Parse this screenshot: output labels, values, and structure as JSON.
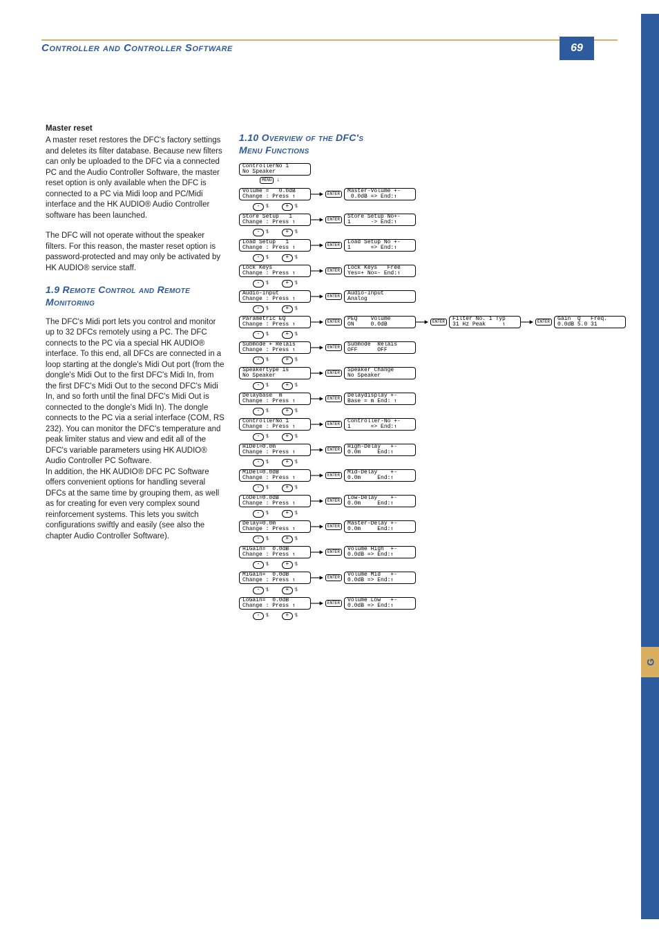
{
  "header": {
    "title": "Controller and Controller Software",
    "page": "69"
  },
  "side_tab": "G",
  "left": {
    "h1": "Master reset",
    "p1": "A master reset restores the DFC's factory settings and deletes its filter database. Because new filters can only be uploaded to the DFC via a connected PC and the Audio Controller Software, the master reset option is only available when the DFC is connected to a PC via Midi loop and PC/Midi interface and the HK AUDIO® Audio Controller software has been launched.",
    "p2": "The DFC will not operate without the speaker filters. For this reason, the master reset option is password-protected and may only be activated by HK AUDIO® service staff.",
    "sec19": "1.9 Remote Control and Remote Monitoring",
    "p3": "The DFC's Midi port lets you control and monitor up to 32 DFCs remotely using a PC. The DFC connects to the PC via a special HK AUDIO® interface. To this end, all DFCs are connected in a loop starting at the dongle's Midi Out port (from the dongle's Midi Out to the first DFC's Midi In, from the first DFC's Midi Out to the second DFC's Midi In, and so forth until the final DFC's Midi Out is connected to the dongle's Midi In). The dongle connects to the PC via a serial interface (COM, RS 232). You can monitor the DFC's temperature and peak limiter status and view and edit all of the DFC's variable parameters using HK AUDIO® Audio Controller PC Software.",
    "p4": "In addition, the HK AUDIO® DFC PC Software offers convenient options for handling several DFCs at the same time by grouping them, as well as for cre­ating  for even very complex sound reinforcement systems. This lets you switch configurations swiftly and easily (see also the chapter Audio Controller Software)."
  },
  "right": {
    "sec110": "1.10 Overview of the DFC's Menu Functions"
  },
  "labels": {
    "enter": "ENTER",
    "menu": "MENU"
  },
  "menu": {
    "start": "ControllerNo 1\nNo Speaker",
    "peq_extra1": "Filter No. 1 Typ\n31 Hz Peak     ↿",
    "peq_extra2": "Gain  Q   Freq.\n0.0dB 5.0 31",
    "rows": [
      {
        "l": "Volume =   0.0dB\nChange : Press ↿",
        "r": "Master-Volume +-\n 0.0dB => End:↿"
      },
      {
        "l": "Store Setup   1\nChange : Press ↿",
        "r": "Store Setup No+-\n1      -> End:↿"
      },
      {
        "l": "Load Setup   1\nChange : Press ↿",
        "r": "Load Setup No +-\n1      => End:↿"
      },
      {
        "l": "Lock Keys\nChange : Press ↿",
        "r": "Lock Keys   Free\nYes=+ No=- End:↿"
      },
      {
        "l": "Audio-Input\nChange : Press ↿",
        "r": "Audio-Input\nAnalog"
      },
      {
        "l": "Parametric EQ\nChange : Press ↿",
        "r": "PEQ    Volume\nON     0.0dB"
      },
      {
        "l": "Submode + Relais\nChange : Press ↿",
        "r": "Submode  Relais\nOFF      OFF"
      },
      {
        "l": "Speakertype is\nNo Speaker",
        "r": "Speaker Change\nNo Speaker"
      },
      {
        "l": "Delaybase  m\nChange : Press ↿",
        "r": "Delaydisplay +-\nBase = m End: ↿"
      },
      {
        "l": "ControllerNo 1\nChange : Press ↿",
        "r": "Controller-No +-\n1      => End:↿"
      },
      {
        "l": "HiDel=0.0m\nChange : Press ↿",
        "r": "High-Delay   +-\n0.0m     End:↿"
      },
      {
        "l": "MiDel=0.0dB\nChange : Press ↿",
        "r": "Mid-Delay    +-\n0.0m     End:↿"
      },
      {
        "l": "LoDel=0.0dB\nChange : Press ↿",
        "r": "Low-Delay    +-\n0.0m     End:↿"
      },
      {
        "l": "Delay=0.0m\nChange : Press ↿",
        "r": "Master-Delay +-\n0.0m     End:↿"
      },
      {
        "l": "HiGain=  0.0dB\nChange : Press ↿",
        "r": "Volume High  +-\n0.0dB => End:↿"
      },
      {
        "l": "MiGain=  0.0dB\nChange : Press ↿",
        "r": "Volume Mid   +-\n0.0dB => End:↿"
      },
      {
        "l": "LoGain=  0.0dB\nChange : Press ↿",
        "r": "Volume Low   +-\n0.0dB => End:↿"
      }
    ]
  }
}
